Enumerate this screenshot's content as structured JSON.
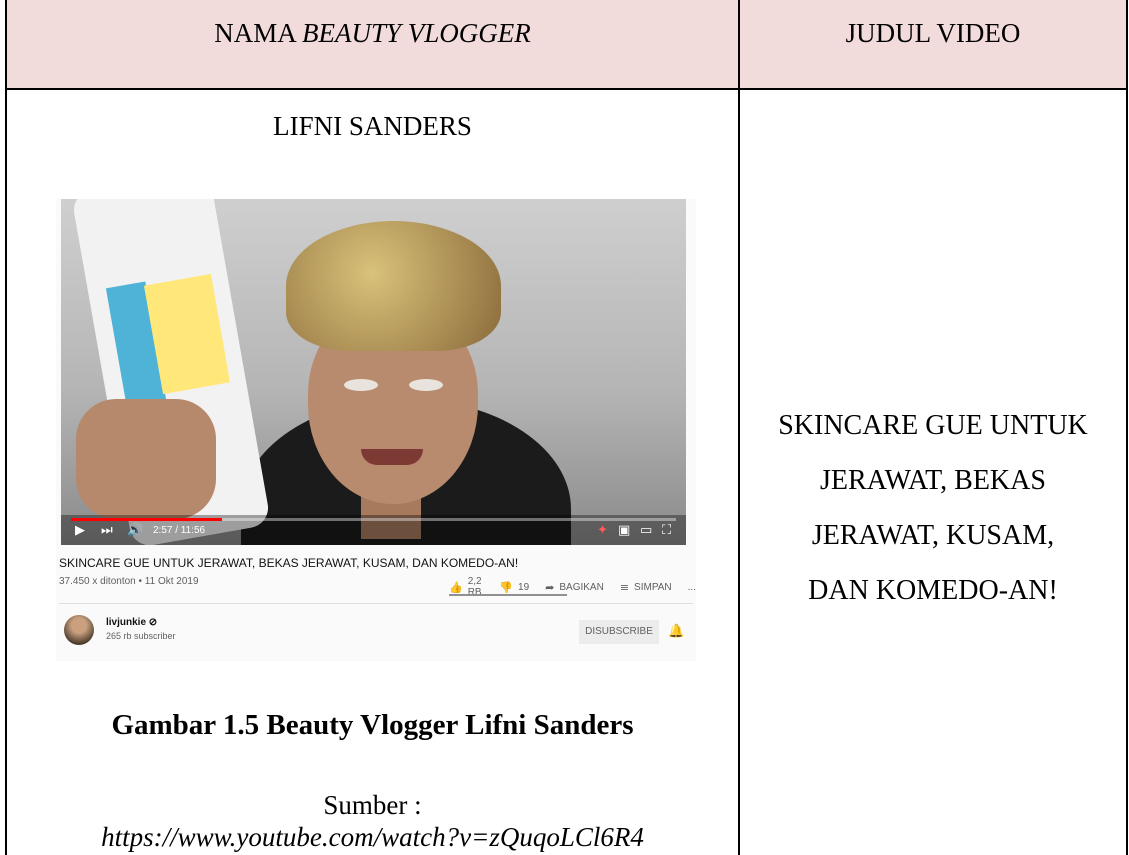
{
  "table": {
    "header_name_prefix": "NAMA ",
    "header_name_italic": "BEAUTY VLOGGER",
    "header_title": "JUDUL VIDEO",
    "header_bg": "#f2dcdb",
    "vlogger_name": "LIFNI SANDERS",
    "video_title_lines": [
      "SKINCARE GUE UNTUK",
      "JERAWAT, BEKAS",
      "JERAWAT, KUSAM,",
      "DAN KOMEDO-AN!"
    ]
  },
  "video": {
    "time": "2:57 / 11:56",
    "progress_fraction": 0.25,
    "title": "SKINCARE GUE UNTUK JERAWAT, BEKAS JERAWAT, KUSAM, DAN KOMEDO-AN!",
    "meta": "37.450 x ditonton • 11 Okt 2019",
    "likes": "2,2 RB",
    "dislikes": "19",
    "share": "BAGIKAN",
    "save": "SIMPAN",
    "more": "...",
    "channel": "livjunkie ⊘",
    "subscribers": "265 rb subscriber",
    "subscribe_button": "DISUBSCRIBE"
  },
  "caption": "Gambar 1.5 Beauty Vlogger Lifni Sanders",
  "source_label": "Sumber :",
  "source_url": "https://www.youtube.com/watch?v=zQuqoLCl6R4"
}
